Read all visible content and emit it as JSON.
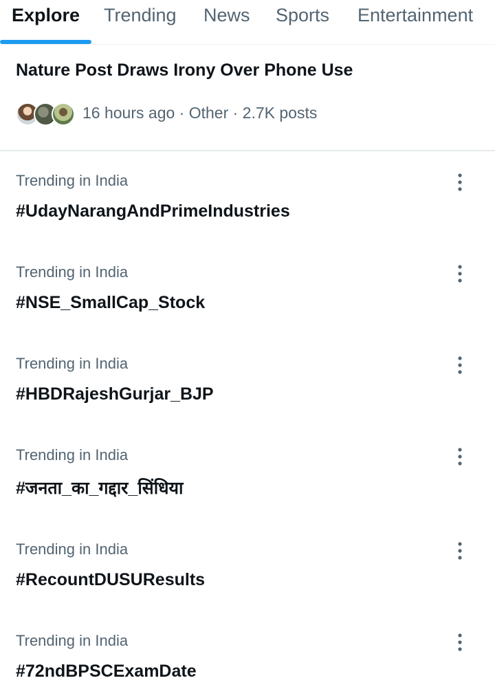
{
  "tabs": [
    {
      "label": "Explore",
      "active": true
    },
    {
      "label": "Trending",
      "active": false
    },
    {
      "label": "News",
      "active": false
    },
    {
      "label": "Sports",
      "active": false
    },
    {
      "label": "Entertainment",
      "active": false
    }
  ],
  "news": {
    "title": "Nature Post Draws Irony Over Phone Use",
    "meta": "16 hours ago · Other · 2.7K posts"
  },
  "trends": [
    {
      "context": "Trending in India",
      "name": "#UdayNarangAndPrimeIndustries"
    },
    {
      "context": "Trending in India",
      "name": "#NSE_SmallCap_Stock"
    },
    {
      "context": "Trending in India",
      "name": "#HBDRajeshGurjar_BJP"
    },
    {
      "context": "Trending in India",
      "name": "#जनता_का_गद्दार_सिंधिया"
    },
    {
      "context": "Trending in India",
      "name": "#RecountDUSUResults"
    },
    {
      "context": "Trending in India",
      "name": "#72ndBPSCExamDate"
    }
  ],
  "icons": {
    "more": "more-vertical-icon"
  },
  "colors": {
    "accent": "#1d9bf0",
    "text_primary": "#0f1419",
    "text_secondary": "#536471"
  }
}
